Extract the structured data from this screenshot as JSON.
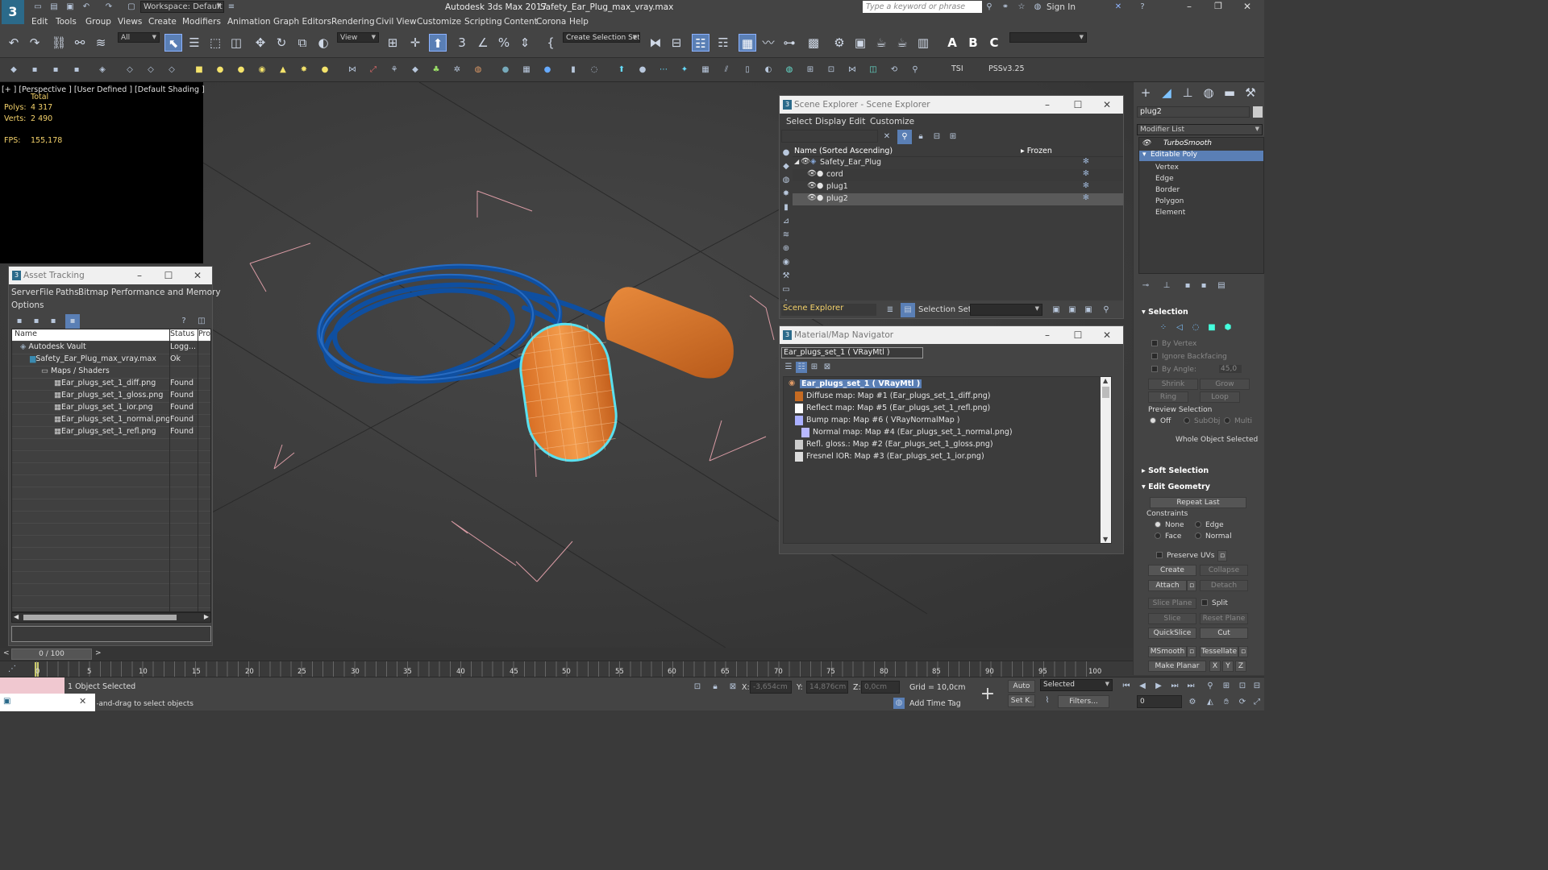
{
  "titlebar": {
    "workspace": "Workspace: Default",
    "app_title": "Autodesk 3ds Max 2017",
    "file_title": "Safety_Ear_Plug_max_vray.max",
    "search_placeholder": "Type a keyword or phrase",
    "sign_in": "Sign In"
  },
  "menubar": [
    "Edit",
    "Tools",
    "Group",
    "Views",
    "Create",
    "Modifiers",
    "Animation",
    "Graph Editors",
    "Rendering",
    "Civil View",
    "Customize",
    "Scripting",
    "Content",
    "Corona",
    "Help"
  ],
  "toolbar": {
    "filter": "All",
    "view": "View",
    "selection_set": "Create Selection Set"
  },
  "toolbar2": {
    "tsi": "TSI",
    "pss": "PSSv3.25"
  },
  "viewport": {
    "label": "[+ ] [Perspective ]  [User Defined ]  [Default Shading ]",
    "total": "Total",
    "polys_label": "Polys:",
    "polys": "4 317",
    "verts_label": "Verts:",
    "verts": "2 490",
    "fps_label": "FPS:",
    "fps": "155,178"
  },
  "asset_tracking": {
    "title": "Asset Tracking",
    "menus": [
      "Server",
      "File",
      "Paths",
      "Bitmap Performance and Memory",
      "Options"
    ],
    "columns": [
      "Name",
      "Status",
      "Pro"
    ],
    "rows": [
      {
        "name": "Autodesk Vault",
        "status": "Logg..."
      },
      {
        "name": "Safety_Ear_Plug_max_vray.max",
        "status": "Ok"
      },
      {
        "name": "Maps / Shaders",
        "status": ""
      },
      {
        "name": "Ear_plugs_set_1_diff.png",
        "status": "Found"
      },
      {
        "name": "Ear_plugs_set_1_gloss.png",
        "status": "Found"
      },
      {
        "name": "Ear_plugs_set_1_ior.png",
        "status": "Found"
      },
      {
        "name": "Ear_plugs_set_1_normal.png",
        "status": "Found"
      },
      {
        "name": "Ear_plugs_set_1_refl.png",
        "status": "Found"
      }
    ]
  },
  "scene_explorer": {
    "title": "Scene Explorer - Scene Explorer",
    "menus": [
      "Select",
      "Display",
      "Edit",
      "Customize"
    ],
    "col_name": "Name (Sorted Ascending)",
    "col_frozen": "▸ Frozen",
    "items": [
      {
        "name": "Safety_Ear_Plug"
      },
      {
        "name": "cord"
      },
      {
        "name": "plug1"
      },
      {
        "name": "plug2"
      }
    ],
    "footer_explorer": "Scene Explorer",
    "footer_selset": "Selection Set:"
  },
  "material_navigator": {
    "title": "Material/Map Navigator",
    "material_field": "Ear_plugs_set_1  ( VRayMtl )",
    "root": "Ear_plugs_set_1  ( VRayMtl )",
    "maps": [
      "Diffuse map: Map #1 (Ear_plugs_set_1_diff.png)",
      "Reflect map: Map #5 (Ear_plugs_set_1_refl.png)",
      "Bump map: Map #6  ( VRayNormalMap )",
      "Normal map: Map #4 (Ear_plugs_set_1_normal.png)",
      "Refl. gloss.: Map #2 (Ear_plugs_set_1_gloss.png)",
      "Fresnel IOR: Map #3 (Ear_plugs_set_1_ior.png)"
    ]
  },
  "command_panel": {
    "object_name": "plug2",
    "modifier_list": "Modifier List",
    "stack": [
      "TurboSmooth",
      "Editable Poly",
      "Vertex",
      "Edge",
      "Border",
      "Polygon",
      "Element"
    ],
    "selection_head": "Selection",
    "by_vertex": "By Vertex",
    "ignore_backfacing": "Ignore Backfacing",
    "by_angle": "By Angle:",
    "angle_value": "45,0",
    "shrink": "Shrink",
    "grow": "Grow",
    "ring": "Ring",
    "loop": "Loop",
    "preview_selection": "Preview Selection",
    "off": "Off",
    "subobj": "SubObj",
    "multi": "Multi",
    "whole_object": "Whole Object Selected",
    "soft_selection": "Soft Selection",
    "edit_geometry": "Edit Geometry",
    "repeat_last": "Repeat Last",
    "constraints": "Constraints",
    "none": "None",
    "edge": "Edge",
    "face": "Face",
    "normal": "Normal",
    "preserve_uvs": "Preserve UVs",
    "create": "Create",
    "collapse": "Collapse",
    "attach": "Attach",
    "detach": "Detach",
    "slice_plane": "Slice Plane",
    "split": "Split",
    "slice": "Slice",
    "reset_plane": "Reset Plane",
    "quickslice": "QuickSlice",
    "cut": "Cut",
    "msmooth": "MSmooth",
    "tessellate": "Tessellate",
    "make_planar": "Make Planar",
    "x": "X",
    "y": "Y",
    "z": "Z"
  },
  "timeline": {
    "frame": "0 / 100",
    "ticks": [
      "0",
      "5",
      "10",
      "15",
      "20",
      "25",
      "30",
      "35",
      "40",
      "45",
      "50",
      "55",
      "60",
      "65",
      "70",
      "75",
      "80",
      "85",
      "90",
      "95",
      "100"
    ]
  },
  "status": {
    "selected": "1 Object Selected",
    "hint": "Click-and-drag to select objects",
    "x_label": "X:",
    "x_value": "-3,654cm",
    "y_label": "Y:",
    "y_value": "14,876cm",
    "z_label": "Z:",
    "z_value": "0,0cm",
    "grid": "Grid = 10,0cm",
    "auto": "Auto",
    "set_key": "Set K.",
    "selected_dropdown": "Selected",
    "filters": "Filters...",
    "add_time_tag": "Add Time Tag",
    "frame_value": "0"
  }
}
